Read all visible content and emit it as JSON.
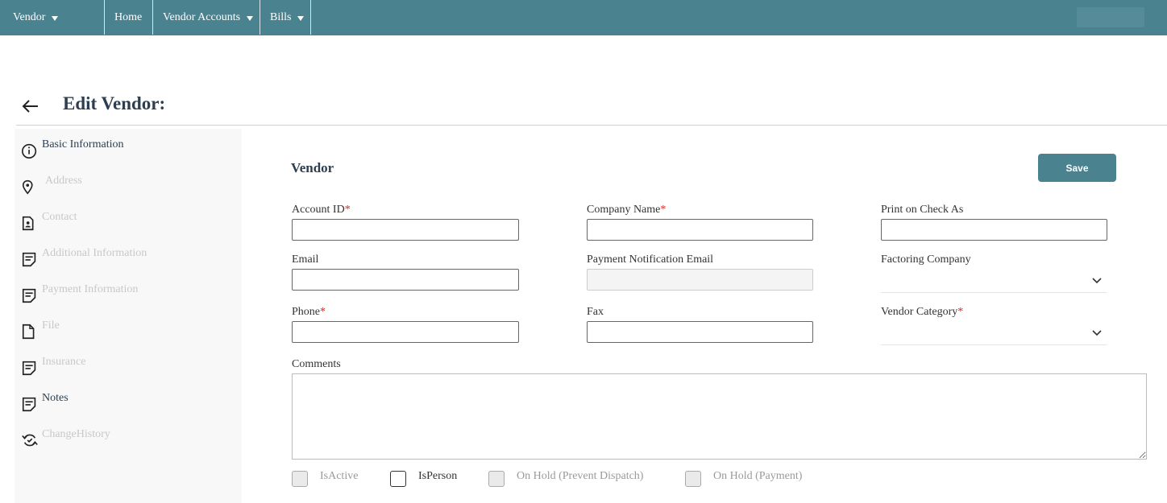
{
  "nav": {
    "vendor": "Vendor",
    "home": "Home",
    "vendor_accounts": "Vendor Accounts",
    "bills": "Bills"
  },
  "header": {
    "title": "Edit Vendor:"
  },
  "sidebar": {
    "items": [
      {
        "label": "Basic Information",
        "icon": "info-icon",
        "active": true
      },
      {
        "label": "Address",
        "icon": "location-pin-icon",
        "active": false
      },
      {
        "label": "Contact",
        "icon": "contact-card-icon",
        "active": false
      },
      {
        "label": "Additional Information",
        "icon": "note-icon",
        "active": false
      },
      {
        "label": "Payment Information",
        "icon": "note-icon",
        "active": false
      },
      {
        "label": "File",
        "icon": "file-icon",
        "active": false
      },
      {
        "label": "Insurance",
        "icon": "note-icon",
        "active": false
      },
      {
        "label": "Notes",
        "icon": "note-icon",
        "active": true
      },
      {
        "label": "ChangeHistory",
        "icon": "history-icon",
        "active": false
      }
    ]
  },
  "form": {
    "section_title": "Vendor",
    "save_label": "Save",
    "required_mark": "*",
    "account_id": {
      "label": "Account ID",
      "value": ""
    },
    "company_name": {
      "label": "Company Name",
      "value": ""
    },
    "print_on_check_as": {
      "label": "Print on Check As",
      "value": ""
    },
    "email": {
      "label": "Email",
      "value": ""
    },
    "payment_notification_email": {
      "label": "Payment Notification Email",
      "value": ""
    },
    "factoring_company": {
      "label": "Factoring Company",
      "value": ""
    },
    "phone": {
      "label": "Phone",
      "value": ""
    },
    "fax": {
      "label": "Fax",
      "value": ""
    },
    "vendor_category": {
      "label": "Vendor Category",
      "value": ""
    },
    "comments": {
      "label": "Comments",
      "value": ""
    },
    "checkboxes": {
      "is_active": {
        "label": "IsActive",
        "checked": false
      },
      "is_person": {
        "label": "IsPerson",
        "checked": false
      },
      "on_hold_dispatch": {
        "label": "On Hold (Prevent Dispatch)",
        "checked": false
      },
      "on_hold_payment": {
        "label": "On Hold (Payment)",
        "checked": false
      }
    }
  },
  "colors": {
    "accent": "#4a8290",
    "title": "#2c3e50",
    "required": "#e02424",
    "muted": "#c8c8c8"
  }
}
